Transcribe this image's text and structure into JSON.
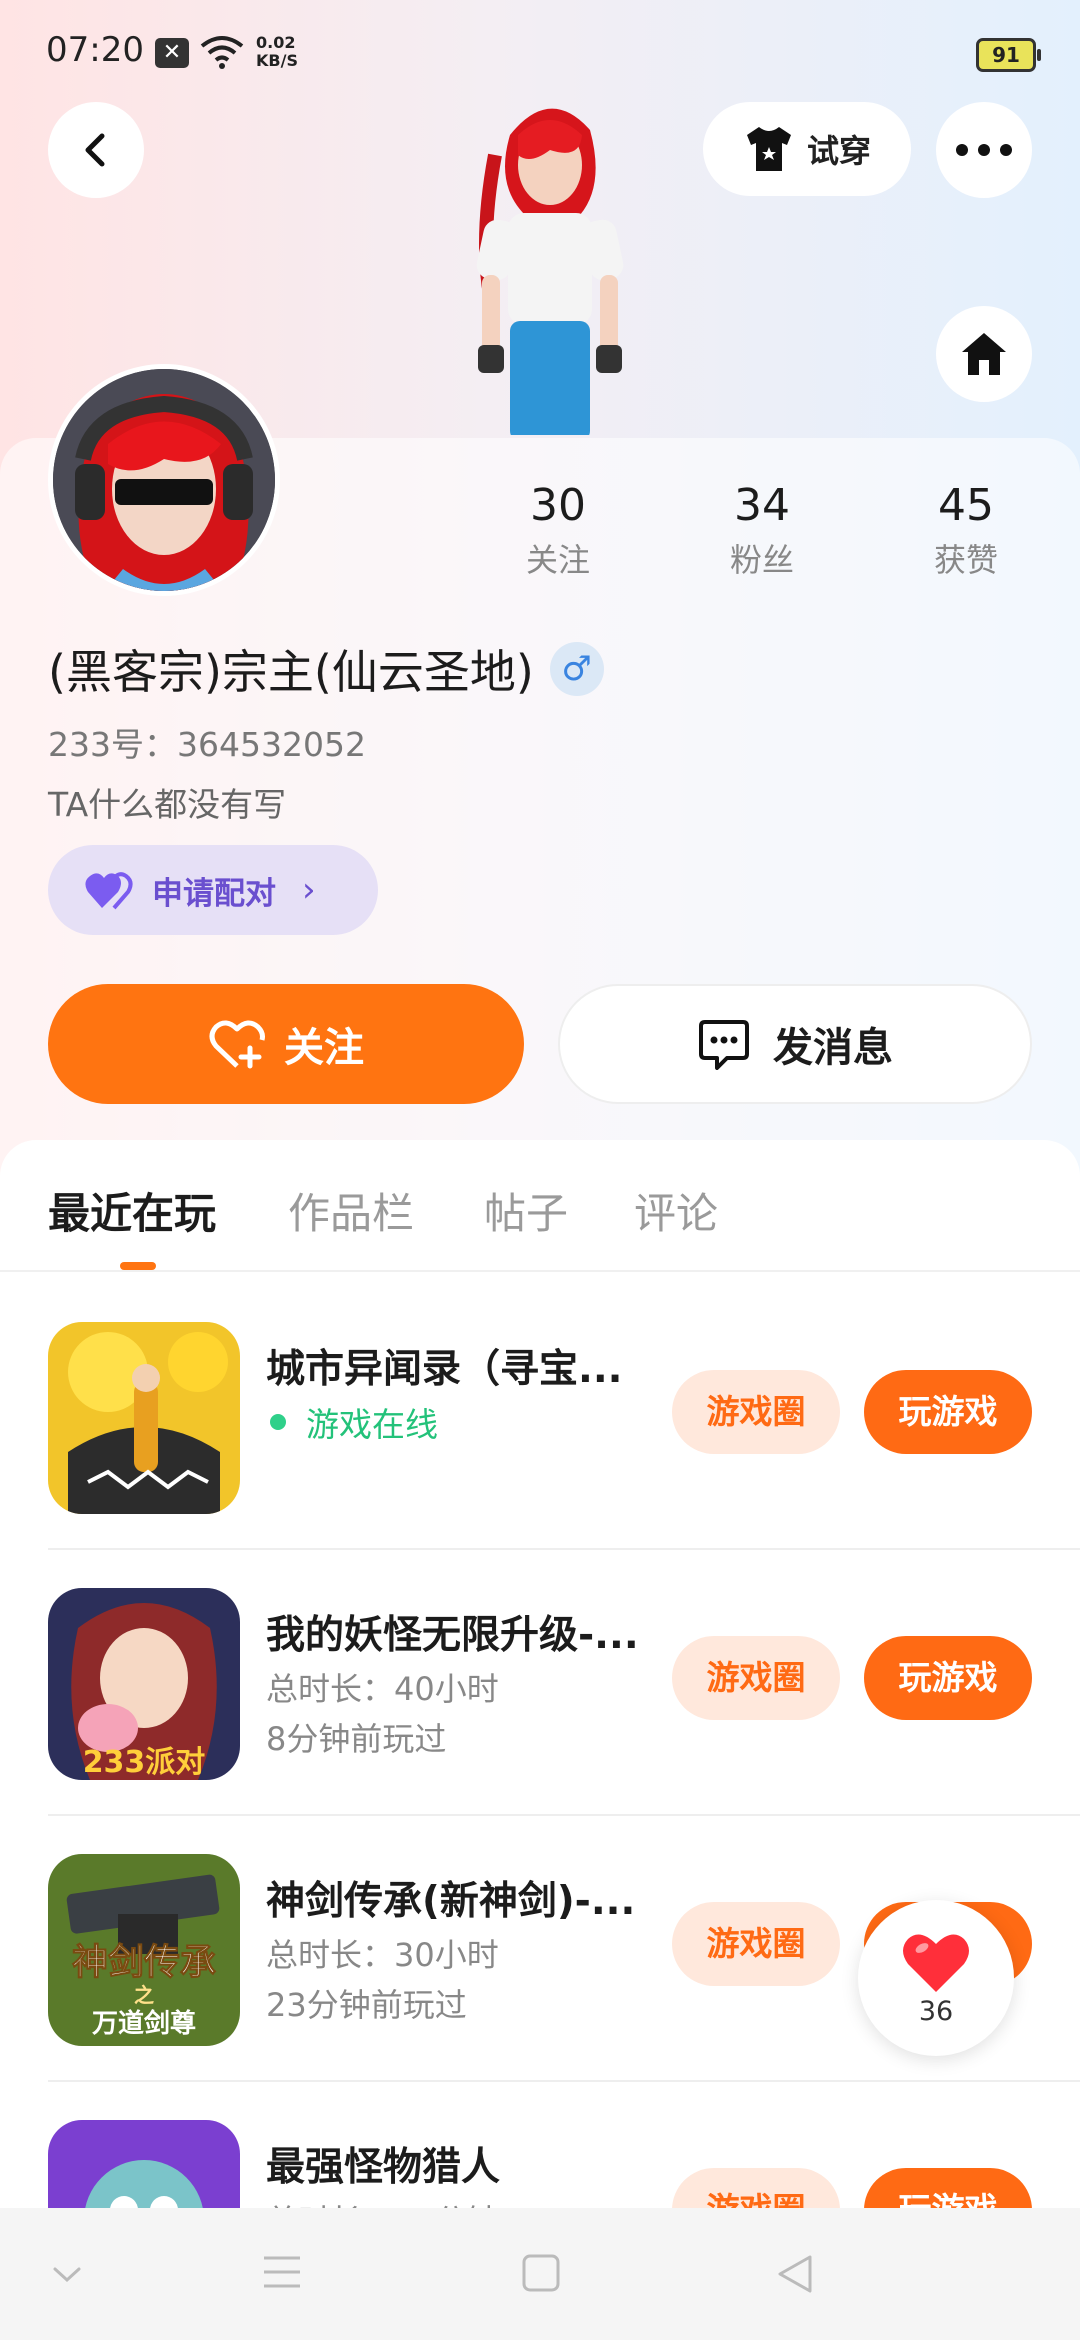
{
  "status_bar": {
    "time": "07:20",
    "network_speed_value": "0.02",
    "network_speed_unit": "KB/S",
    "battery": "91"
  },
  "header": {
    "try_on_label": "试穿"
  },
  "profile": {
    "stats": [
      {
        "value": "30",
        "label": "关注"
      },
      {
        "value": "34",
        "label": "粉丝"
      },
      {
        "value": "45",
        "label": "获赞"
      }
    ],
    "username": "(黑客宗)宗主(仙云圣地)",
    "gender_symbol": "♂",
    "user_id": "233号：364532052",
    "bio": "TA什么都没有写",
    "pair_label": "申请配对",
    "follow_label": "关注",
    "message_label": "发消息"
  },
  "tabs": [
    {
      "label": "最近在玩",
      "active": true
    },
    {
      "label": "作品栏",
      "active": false
    },
    {
      "label": "帖子",
      "active": false
    },
    {
      "label": "评论",
      "active": false
    }
  ],
  "games": [
    {
      "title": "城市异闻录（寻宝...",
      "status": "游戏在线",
      "circle_label": "游戏圈",
      "play_label": "玩游戏"
    },
    {
      "title": "我的妖怪无限升级-...",
      "duration": "总时长：40小时",
      "last_played": "8分钟前玩过",
      "circle_label": "游戏圈",
      "play_label": "玩游戏",
      "thumb_text": "233派对"
    },
    {
      "title": "神剑传承(新神剑)-...",
      "duration": "总时长：30小时",
      "last_played": "23分钟前玩过",
      "circle_label": "游戏圈",
      "play_label": "玩游戏",
      "thumb_text": "神剑传承",
      "thumb_text_2": "之",
      "thumb_text_3": "万道剑尊"
    },
    {
      "title": "最强怪物猎人",
      "duration": "总时长：... 分钟",
      "circle_label": "游戏圈",
      "play_label": "玩游戏"
    }
  ],
  "floating_like": {
    "count": "36"
  },
  "colors": {
    "accent": "#ff7411",
    "pair_purple": "#6a4fcf",
    "online_green": "#23c27a"
  }
}
